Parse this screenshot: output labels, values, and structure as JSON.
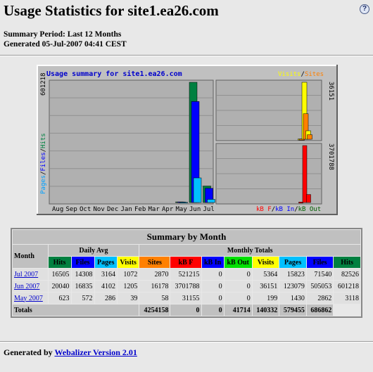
{
  "header": {
    "title": "Usage Statistics for site1.ea26.com",
    "help_icon": "?",
    "summary_period": "Summary Period: Last 12 Months",
    "generated": "Generated 05-Jul-2007 04:41 CEST"
  },
  "graph": {
    "title": "Usage summary for site1.ea26.com",
    "left_axis_label": "Pages/Files/Hits",
    "left_max": "601218",
    "right_top_max": "36151",
    "right_bottom_max": "3701788",
    "legend_top": [
      "Visits",
      "/",
      "Sites"
    ],
    "legend_bottom": [
      "kB F",
      "/",
      "kB In",
      "/",
      "kB Out"
    ],
    "months": [
      "Aug",
      "Sep",
      "Oct",
      "Nov",
      "Dec",
      "Jan",
      "Feb",
      "Mar",
      "Apr",
      "May",
      "Jun",
      "Jul"
    ],
    "colors": {
      "hits": "#008040",
      "files": "#0000ff",
      "pages": "#00c0ff",
      "visits": "#ffff00",
      "sites": "#ff8000",
      "kbf": "#ff0000",
      "kbin": "#0000ff",
      "kbout": "#00e000"
    }
  },
  "chart_data": {
    "type": "bar",
    "categories": [
      "Aug",
      "Sep",
      "Oct",
      "Nov",
      "Dec",
      "Jan",
      "Feb",
      "Mar",
      "Apr",
      "May",
      "Jun",
      "Jul"
    ],
    "series": [
      {
        "name": "Hits",
        "values": [
          0,
          0,
          0,
          0,
          0,
          0,
          0,
          0,
          0,
          3118,
          601218,
          82526
        ]
      },
      {
        "name": "Files",
        "values": [
          0,
          0,
          0,
          0,
          0,
          0,
          0,
          0,
          0,
          2862,
          505053,
          71540
        ]
      },
      {
        "name": "Pages",
        "values": [
          0,
          0,
          0,
          0,
          0,
          0,
          0,
          0,
          0,
          1430,
          123079,
          15823
        ]
      },
      {
        "name": "Visits",
        "values": [
          0,
          0,
          0,
          0,
          0,
          0,
          0,
          0,
          0,
          199,
          36151,
          5364
        ]
      },
      {
        "name": "Sites",
        "values": [
          0,
          0,
          0,
          0,
          0,
          0,
          0,
          0,
          0,
          58,
          16178,
          2870
        ]
      },
      {
        "name": "kB F",
        "values": [
          0,
          0,
          0,
          0,
          0,
          0,
          0,
          0,
          0,
          31155,
          3701788,
          521215
        ]
      },
      {
        "name": "kB In",
        "values": [
          0,
          0,
          0,
          0,
          0,
          0,
          0,
          0,
          0,
          0,
          0,
          0
        ]
      },
      {
        "name": "kB Out",
        "values": [
          0,
          0,
          0,
          0,
          0,
          0,
          0,
          0,
          0,
          0,
          0,
          0
        ]
      }
    ]
  },
  "table": {
    "title": "Summary by Month",
    "month_header": "Month",
    "daily_avg_header": "Daily Avg",
    "monthly_totals_header": "Monthly Totals",
    "columns": [
      "Hits",
      "Files",
      "Pages",
      "Visits",
      "Sites",
      "kB F",
      "kB In",
      "kB Out",
      "Visits",
      "Pages",
      "Files",
      "Hits"
    ],
    "rows": [
      {
        "month": "Jul 2007",
        "values": [
          "16505",
          "14308",
          "3164",
          "1072",
          "2870",
          "521215",
          "0",
          "0",
          "5364",
          "15823",
          "71540",
          "82526"
        ]
      },
      {
        "month": "Jun 2007",
        "values": [
          "20040",
          "16835",
          "4102",
          "1205",
          "16178",
          "3701788",
          "0",
          "0",
          "36151",
          "123079",
          "505053",
          "601218"
        ]
      },
      {
        "month": "May 2007",
        "values": [
          "623",
          "572",
          "286",
          "39",
          "58",
          "31155",
          "0",
          "0",
          "199",
          "1430",
          "2862",
          "3118"
        ]
      }
    ],
    "totals_label": "Totals",
    "totals": [
      "4254158",
      "0",
      "0",
      "41714",
      "140332",
      "579455",
      "686862"
    ]
  },
  "footer": {
    "prefix": "Generated by",
    "link": "Webalizer Version 2.01"
  }
}
